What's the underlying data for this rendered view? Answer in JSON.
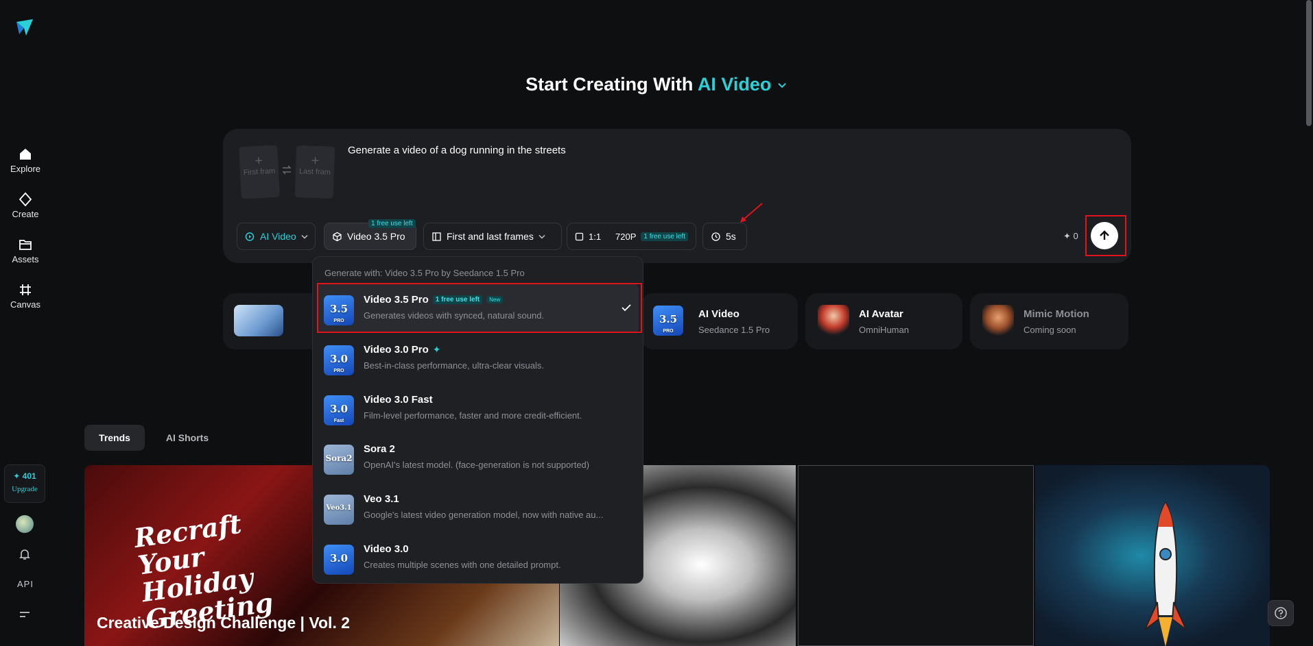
{
  "sidebar": {
    "items": [
      {
        "label": "Explore",
        "icon": "home-icon"
      },
      {
        "label": "Create",
        "icon": "sparkle-diamond-icon"
      },
      {
        "label": "Assets",
        "icon": "folder-icon"
      },
      {
        "label": "Canvas",
        "icon": "frame-icon"
      }
    ],
    "credits": "✦ 401",
    "upgrade": "Upgrade",
    "api": "API"
  },
  "heading": {
    "prefix": "Start Creating With ",
    "accent": "AI Video"
  },
  "prompt": {
    "first_frame": "First fram",
    "last_frame": "Last fram",
    "text": "Generate a video of a dog running in the streets"
  },
  "toolbar": {
    "mode": "AI Video",
    "model": "Video 3.5 Pro",
    "model_tag": "1 free use left",
    "frames": "First and last frames",
    "ratio": "1:1",
    "resolution": "720P",
    "resolution_tag": "1 free use left",
    "duration": "5s",
    "cost": "✦ 0"
  },
  "dropdown": {
    "header": "Generate with: Video 3.5 Pro by Seedance 1.5 Pro",
    "items": [
      {
        "name": "Video 3.5 Pro",
        "tag": "1 free use left",
        "new": "New",
        "desc": "Generates videos with synced, natural sound.",
        "icon_text": "3.5",
        "icon_sub": "PRO"
      },
      {
        "name": "Video 3.0 Pro",
        "desc": "Best-in-class performance, ultra-clear visuals.",
        "icon_text": "3.0",
        "icon_sub": "PRO"
      },
      {
        "name": "Video 3.0 Fast",
        "desc": "Film-level performance, faster and more credit-efficient.",
        "icon_text": "3.0",
        "icon_sub": "Fast"
      },
      {
        "name": "Sora 2",
        "desc": "OpenAI's latest model. (face-generation is not supported)",
        "icon_text": "Sora2"
      },
      {
        "name": "Veo 3.1",
        "desc": "Google's latest video generation model, now with native au...",
        "icon_text": "Veo3.1"
      },
      {
        "name": "Video 3.0",
        "desc": "Creates multiple scenes with one detailed prompt.",
        "icon_text": "3.0"
      }
    ]
  },
  "cards": [
    {
      "title": "AI Video",
      "sub": "Seedance 1.5 Pro",
      "icon_text": "3.5",
      "icon_sub": "PRO"
    },
    {
      "title": "AI Avatar",
      "sub": "OmniHuman"
    },
    {
      "title": "Mimic Motion",
      "sub": "Coming soon"
    }
  ],
  "tabs": [
    "Trends",
    "AI Shorts"
  ],
  "gallery": {
    "banner_script": "Recraft Your Holiday Greeting",
    "banner_title": "Creative Design Challenge | Vol. 2"
  },
  "colors": {
    "accent": "#2ad1d7",
    "highlight": "#e0141b",
    "background": "#0e0f11"
  }
}
